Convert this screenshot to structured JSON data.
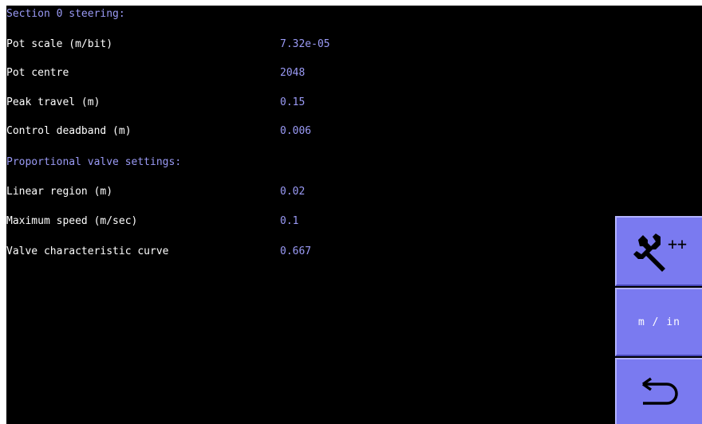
{
  "section_steering": {
    "title": "Section 0 steering:",
    "rows": [
      {
        "label": "Pot scale (m/bit)",
        "value": "7.32e-05"
      },
      {
        "label": "Pot centre",
        "value": "2048"
      },
      {
        "label": "Peak travel (m)",
        "value": "0.15"
      },
      {
        "label": "Control deadband (m)",
        "value": "0.006"
      }
    ]
  },
  "section_valve": {
    "title": "Proportional valve settings:",
    "rows": [
      {
        "label": "Linear region (m)",
        "value": "0.02"
      },
      {
        "label": "Maximum speed (m/sec)",
        "value": "0.1"
      },
      {
        "label": "Valve characteristic curve",
        "value": "0.667"
      }
    ]
  },
  "buttons": {
    "advanced": {
      "icon": "wrench-plus-plus-icon",
      "label": "++"
    },
    "units": {
      "label": "m / in"
    },
    "back": {
      "icon": "return-arrow-icon"
    }
  },
  "colors": {
    "background": "#000000",
    "label_text": "#ffffff",
    "accent_text": "#9a9af5",
    "button_fill": "#7a7af0"
  }
}
